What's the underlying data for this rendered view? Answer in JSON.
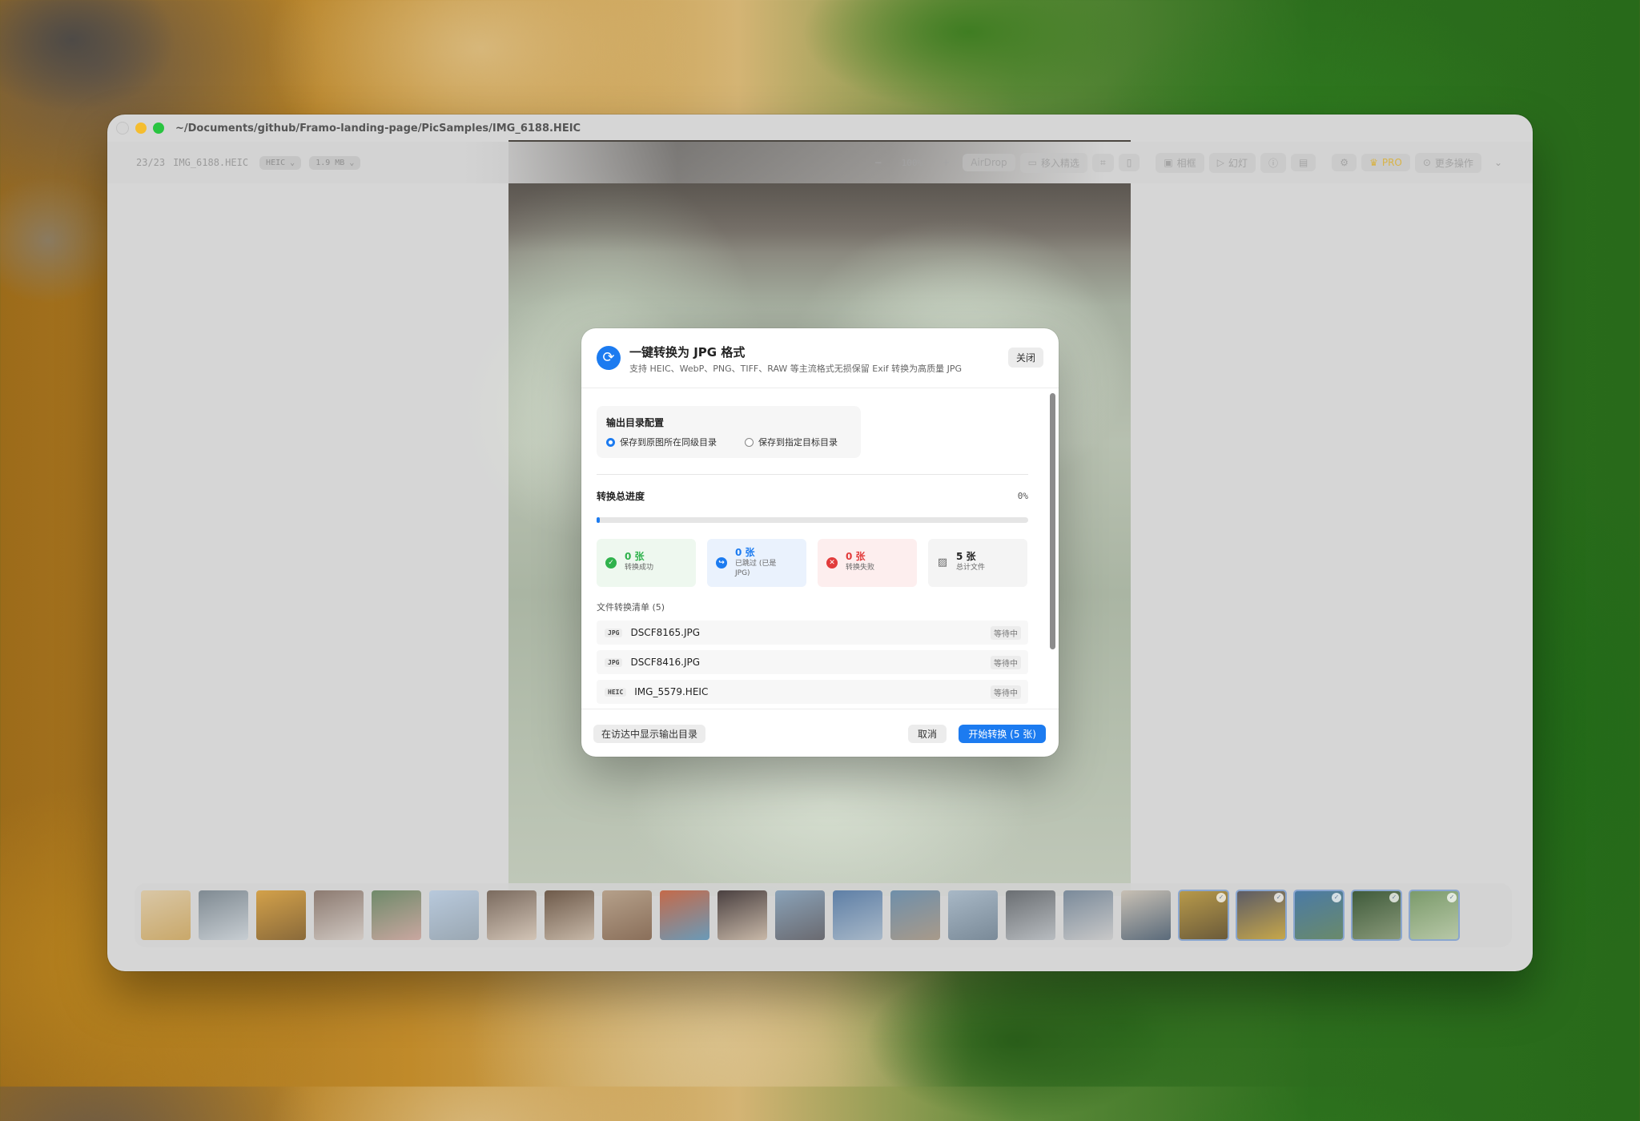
{
  "window": {
    "title_path": "~/Documents/github/Framo-landing-page/PicSamples/IMG_6188.HEIC"
  },
  "toolbar": {
    "counter": "23/23",
    "filename": "IMG_6188.HEIC",
    "format": "HEIC",
    "format_chevron": "⌄",
    "size": "1.9 MB",
    "size_chevron": "⌄",
    "zoom_out": "−",
    "zoom": "100%",
    "zoom_in": "+",
    "airdrop": "AirDrop",
    "move_to": "移入精选",
    "album": "相框",
    "slideshow": "幻灯",
    "pro": "PRO",
    "more": "更多操作",
    "more_chevron": "⌄"
  },
  "dialog": {
    "title": "一键转换为 JPG 格式",
    "subtitle": "支持 HEIC、WebP、PNG、TIFF、RAW 等主流格式无损保留 Exif 转换为高质量 JPG",
    "close_label": "关闭",
    "output": {
      "title": "输出目录配置",
      "option_same": "保存到原图所在同级目录",
      "option_custom": "保存到指定目标目录",
      "selected": "same"
    },
    "progress": {
      "label": "转换总进度",
      "percent_text": "0%",
      "value": 0
    },
    "stats": [
      {
        "value": "0 张",
        "label": "转换成功",
        "icon": "check-icon",
        "color": "#2fb24c",
        "bg": "#eef8ef"
      },
      {
        "value": "0 张",
        "label": "已跳过 (已是JPG)",
        "icon": "skip-arrow-icon",
        "color": "#1c7bf0",
        "bg": "#eaf2fd"
      },
      {
        "value": "0 张",
        "label": "转换失败",
        "icon": "error-x-icon",
        "color": "#e23b3b",
        "bg": "#fdeeee"
      },
      {
        "value": "5 张",
        "label": "总计文件",
        "icon": "image-stack-icon",
        "color": "#222222",
        "bg": "#f4f4f4"
      }
    ],
    "list_title": "文件转换清单 (5)",
    "files": [
      {
        "badge": "JPG",
        "name": "DSCF8165.JPG",
        "status": "等待中"
      },
      {
        "badge": "JPG",
        "name": "DSCF8416.JPG",
        "status": "等待中"
      },
      {
        "badge": "HEIC",
        "name": "IMG_5579.HEIC",
        "status": "等待中"
      }
    ],
    "footer": {
      "finder_label": "在访达中显示输出目录",
      "cancel_label": "取消",
      "start_label": "开始转换 (5 张)"
    }
  },
  "colors": {
    "accent": "#1c7bf0",
    "success": "#2fb24c",
    "danger": "#e23b3b"
  },
  "filmstrip": {
    "thumbs": [
      {
        "c1": "#d9c7a6",
        "c2": "#c9a86a",
        "selected": false
      },
      {
        "c1": "#7f8a92",
        "c2": "#c7cdd2",
        "selected": false
      },
      {
        "c1": "#d3a14a",
        "c2": "#8a6a3a",
        "selected": false
      },
      {
        "c1": "#8c7a70",
        "c2": "#d0c8c2",
        "selected": false
      },
      {
        "c1": "#6f8a6a",
        "c2": "#c9a7a0",
        "selected": false
      },
      {
        "c1": "#b8c9dc",
        "c2": "#9aa7b2",
        "selected": false
      },
      {
        "c1": "#7a6a5e",
        "c2": "#d2c4b6",
        "selected": false
      },
      {
        "c1": "#6e5a4a",
        "c2": "#c7b8a8",
        "selected": false
      },
      {
        "c1": "#b5a08a",
        "c2": "#8a6f5a",
        "selected": false
      },
      {
        "c1": "#c46a4a",
        "c2": "#6a9ab8",
        "selected": false
      },
      {
        "c1": "#4a4040",
        "c2": "#c8b8a8",
        "selected": false
      },
      {
        "c1": "#8aa2b8",
        "c2": "#6a6a70",
        "selected": false
      },
      {
        "c1": "#5e7fa6",
        "c2": "#a8b8c8",
        "selected": false
      },
      {
        "c1": "#6f8faa",
        "c2": "#a89a8a",
        "selected": false
      },
      {
        "c1": "#a8b8c6",
        "c2": "#7a8a98",
        "selected": false
      },
      {
        "c1": "#6a6e72",
        "c2": "#b8bcc0",
        "selected": false
      },
      {
        "c1": "#7a8a9a",
        "c2": "#c8c8c8",
        "selected": false
      },
      {
        "c1": "#c8c0b4",
        "c2": "#5a6a7a",
        "selected": false
      },
      {
        "c1": "#b89a4a",
        "c2": "#6a5a3a",
        "selected": true
      },
      {
        "c1": "#5a5a66",
        "c2": "#c8a84a",
        "selected": true
      },
      {
        "c1": "#4a7aa6",
        "c2": "#6a8a6a",
        "selected": true
      },
      {
        "c1": "#3e5a3a",
        "c2": "#8a9a7a",
        "selected": true
      },
      {
        "c1": "#7a9a6a",
        "c2": "#b8c8a8",
        "selected": true
      }
    ]
  }
}
